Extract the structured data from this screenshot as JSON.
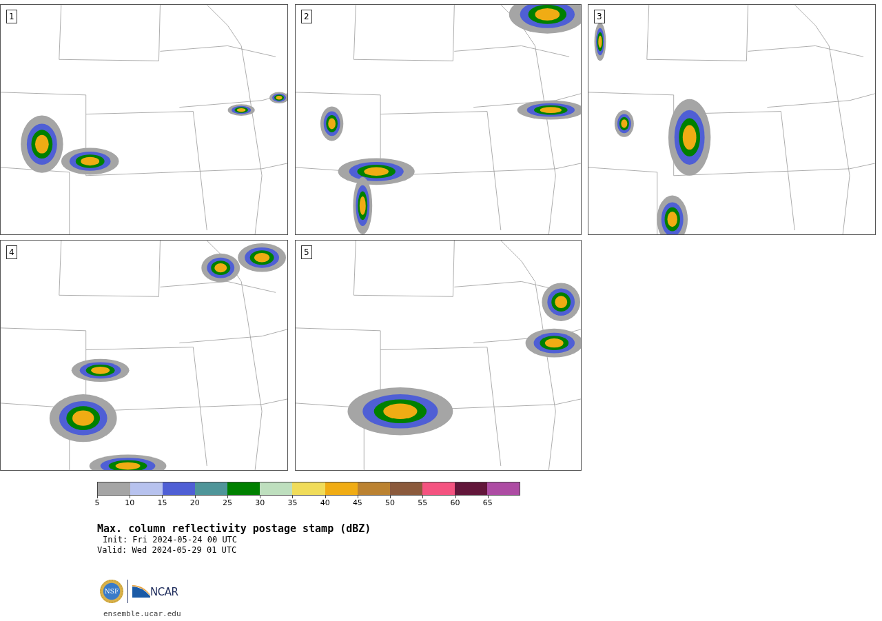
{
  "panels": [
    {
      "label": "1"
    },
    {
      "label": "2"
    },
    {
      "label": "3"
    },
    {
      "label": "4"
    },
    {
      "label": "5"
    }
  ],
  "colorbar": {
    "bins": [
      {
        "color": "#a5a5a5"
      },
      {
        "color": "#b7c2ee"
      },
      {
        "color": "#4f5fd5"
      },
      {
        "color": "#4f9599"
      },
      {
        "color": "#008000"
      },
      {
        "color": "#bedfbe"
      },
      {
        "color": "#f0dc5a"
      },
      {
        "color": "#f0ac14"
      },
      {
        "color": "#bb8231"
      },
      {
        "color": "#8b5a3c"
      },
      {
        "color": "#f45380"
      },
      {
        "color": "#62163a"
      },
      {
        "color": "#ad4ca3"
      }
    ],
    "ticks": [
      "5",
      "10",
      "15",
      "20",
      "25",
      "30",
      "35",
      "40",
      "45",
      "50",
      "55",
      "60",
      "65"
    ]
  },
  "title": "Max. column reflectivity postage stamp (dBZ)",
  "init": "Init: Fri 2024-05-24 00 UTC",
  "valid": "Valid: Wed 2024-05-29 01 UTC",
  "logo": {
    "seal": "NSF",
    "wordmark": "NCAR"
  },
  "url": "ensemble.ucar.edu"
}
